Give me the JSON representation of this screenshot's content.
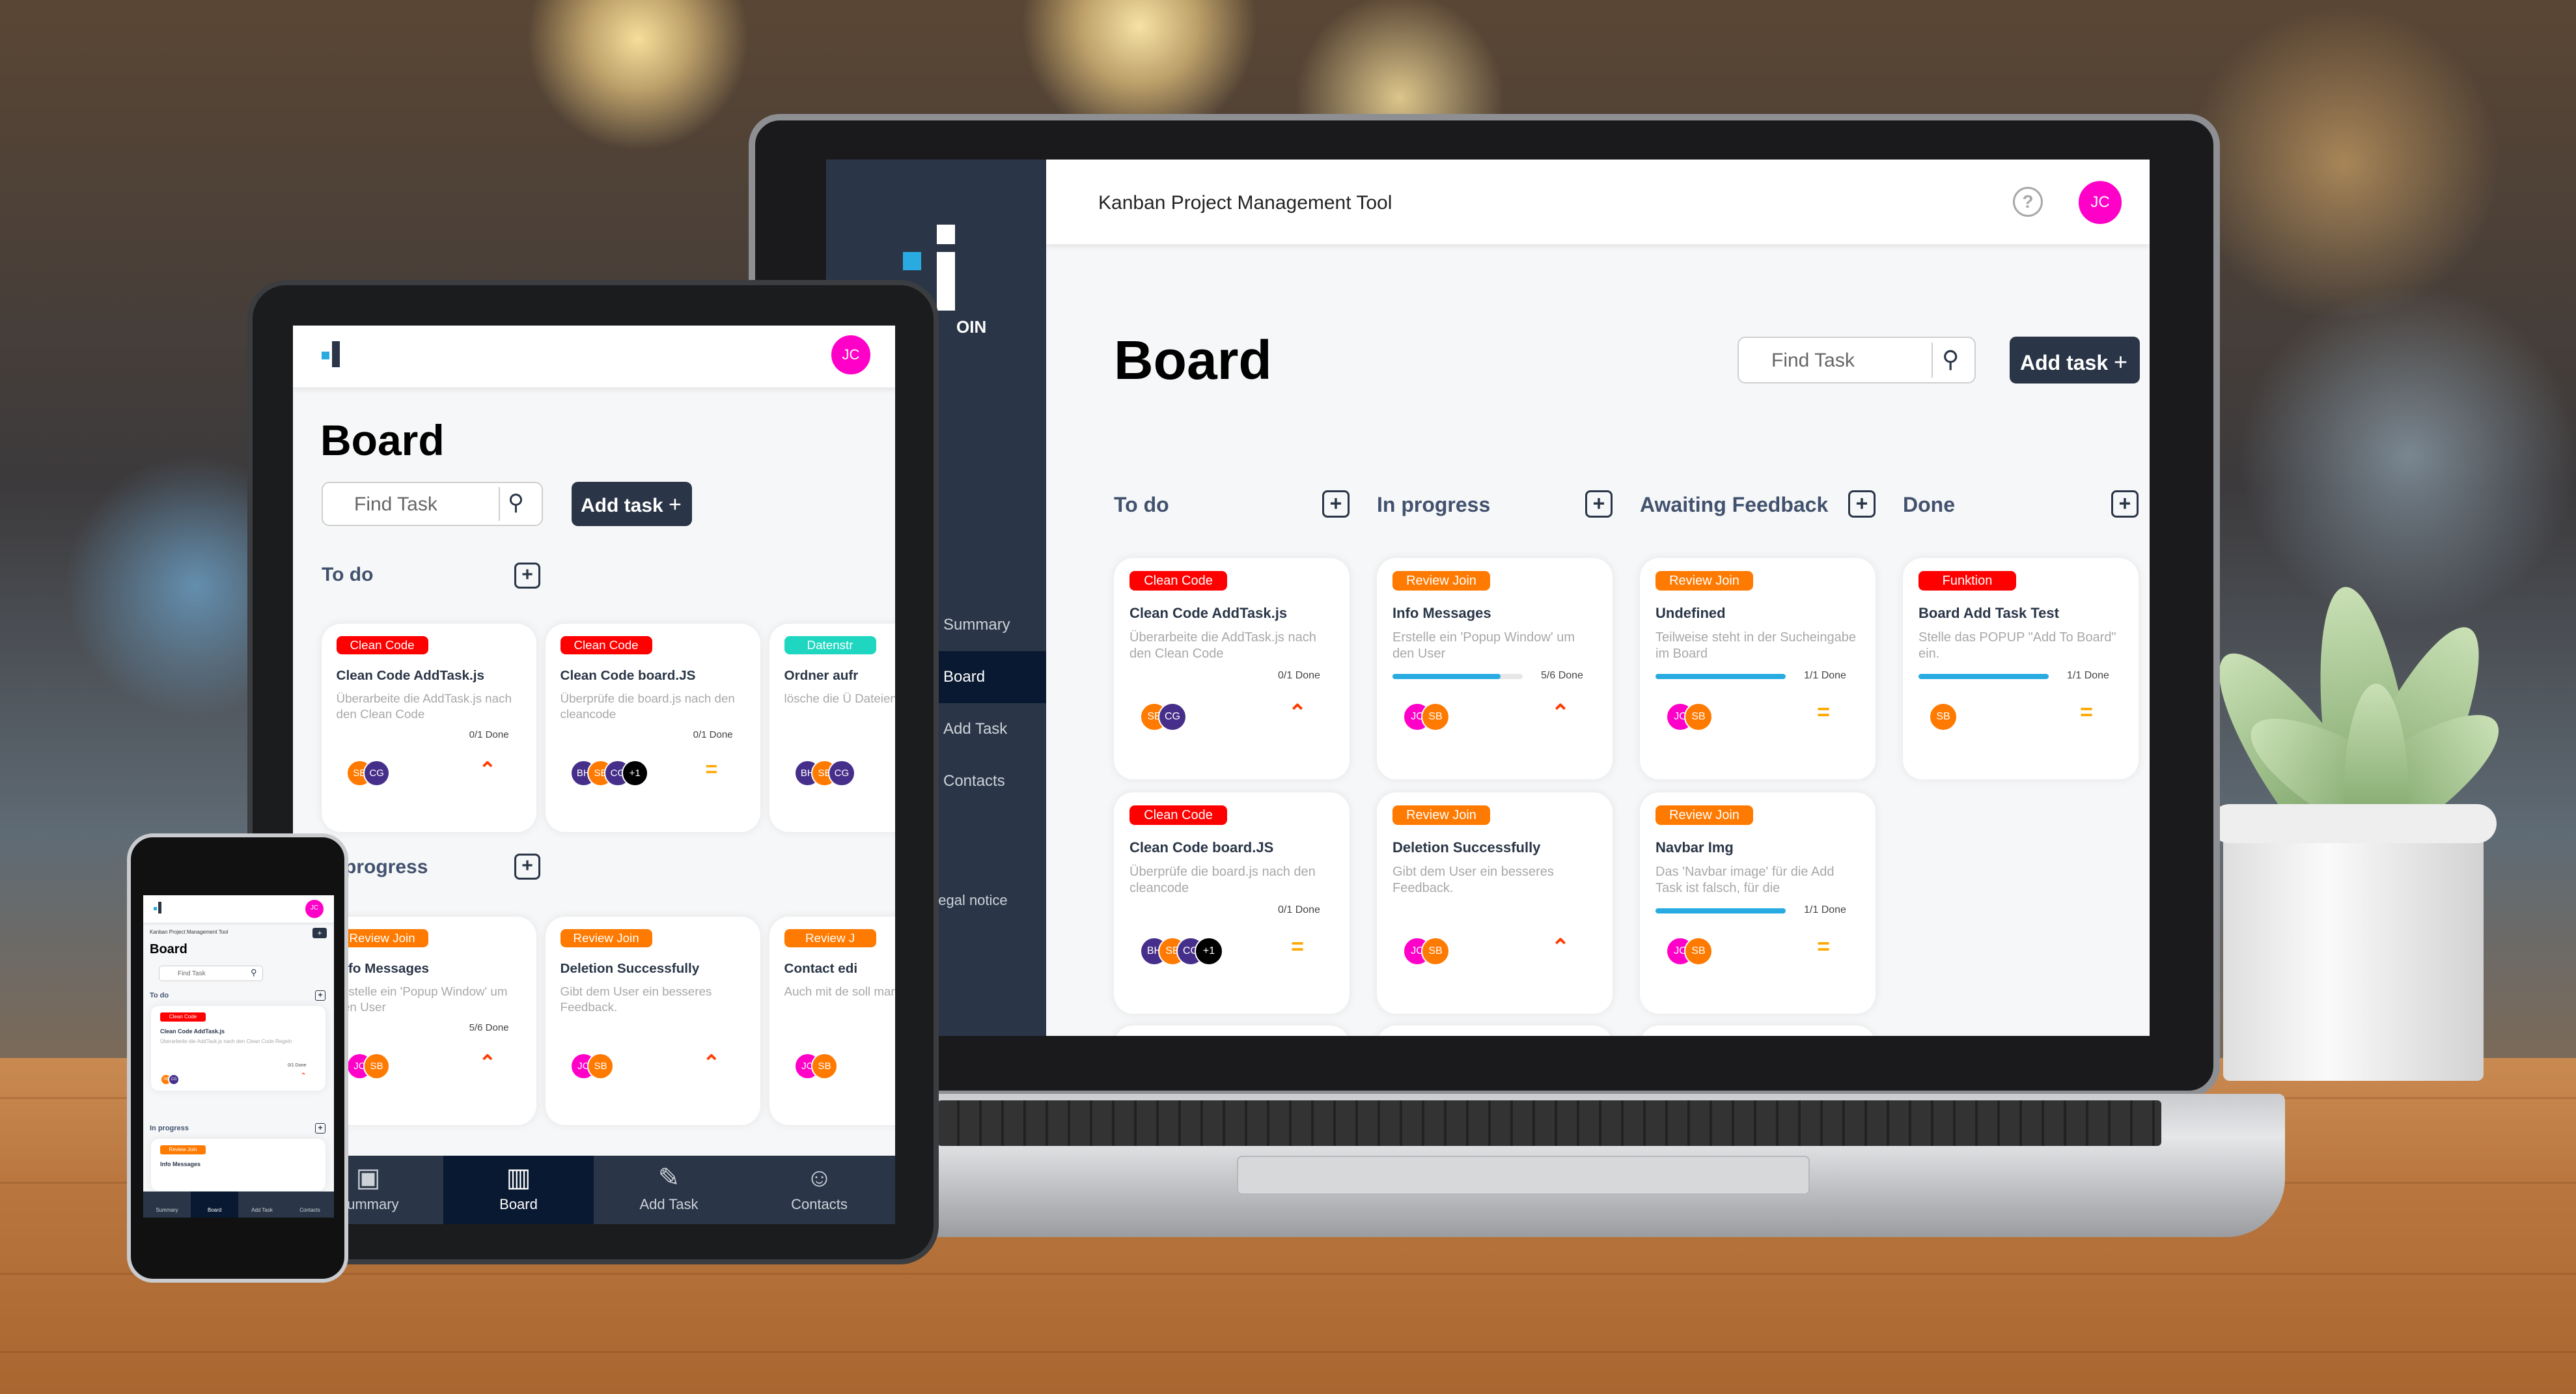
{
  "app": {
    "title": "Kanban Project Management Tool",
    "user_initials": "JC",
    "help_label": "?",
    "logo_letters": "OIN",
    "logo_mark": "j"
  },
  "sidebar": {
    "items": [
      {
        "label": "Summary"
      },
      {
        "label": "Board"
      },
      {
        "label": "Add Task"
      },
      {
        "label": "Contacts"
      }
    ],
    "legal": "Legal notice"
  },
  "board": {
    "title": "Board",
    "search_placeholder": "Find Task",
    "add_task_label": "Add task",
    "add_icon": "+",
    "columns": [
      {
        "title": "To do"
      },
      {
        "title": "In progress"
      },
      {
        "title": "Awaiting Feedback"
      },
      {
        "title": "Done"
      }
    ],
    "cards": [
      {
        "tag": "Clean Code",
        "title": "Clean Code AddTask.js",
        "desc": "Überarbeite die AddTask.js nach den Clean Code",
        "done": "0/1 Done",
        "progress": 0.0,
        "avatars": [
          "SB",
          "CG"
        ],
        "prio": "^"
      },
      {
        "tag": "Clean Code",
        "title": "Clean Code board.JS",
        "desc": "Überprüfe die board.js nach den cleancode",
        "done": "0/1 Done",
        "progress": 0.0,
        "avatars": [
          "BH",
          "SB",
          "CG",
          "+1"
        ],
        "prio": "="
      },
      {
        "tag": "Review Join",
        "title": "Info Messages",
        "desc": "Erstelle ein 'Popup Window' um den User",
        "done": "5/6 Done",
        "progress": 0.83,
        "avatars": [
          "JC",
          "SB"
        ],
        "prio": "^"
      },
      {
        "tag": "Review Join",
        "title": "Deletion Successfully",
        "desc": "Gibt dem User ein besseres Feedback.",
        "done": "",
        "progress": 0.0,
        "avatars": [
          "JC",
          "SB"
        ],
        "prio": "^"
      },
      {
        "tag": "Review Join",
        "title": "Undefined",
        "desc": "Teilweise steht in der Sucheingabe im Board",
        "done": "1/1 Done",
        "progress": 1.0,
        "avatars": [
          "JC",
          "SB"
        ],
        "prio": "="
      },
      {
        "tag": "Review Join",
        "title": "Navbar Img",
        "desc": "Das 'Navbar image' für die Add Task ist falsch, für die",
        "done": "1/1 Done",
        "progress": 1.0,
        "avatars": [
          "JC",
          "SB"
        ],
        "prio": "="
      },
      {
        "tag": "Funktion",
        "title": "Board Add Task Test",
        "desc": "Stelle das POPUP \"Add To Board\" ein.",
        "done": "1/1 Done",
        "progress": 1.0,
        "avatars": [
          "SB"
        ],
        "prio": "="
      }
    ]
  },
  "tablet": {
    "columns": [
      {
        "title": "To do"
      },
      {
        "title": "In progress"
      }
    ],
    "cards": [
      {
        "tag": "Clean Code",
        "title": "Clean Code AddTask.js",
        "desc": "Überarbeite die AddTask.js nach den Clean Code",
        "done": "0/1 Done",
        "avatars": [
          "SB",
          "CG"
        ],
        "prio": "^"
      },
      {
        "tag": "Clean Code",
        "title": "Clean Code board.JS",
        "desc": "Überprüfe die board.js nach den cleancode",
        "done": "0/1 Done",
        "avatars": [
          "BH",
          "SB",
          "CG",
          "+1"
        ],
        "prio": "="
      },
      {
        "tag": "Datenstr",
        "title": "Ordner aufr",
        "desc": "lösche die Ü Dateien im j",
        "done": "",
        "avatars": [
          "BH",
          "SB",
          "CG"
        ],
        "prio": ""
      },
      {
        "tag": "Review Join",
        "title": "Info Messages",
        "desc": "Erstelle ein 'Popup Window' um den User",
        "done": "5/6 Done",
        "avatars": [
          "JC",
          "SB"
        ],
        "prio": "^"
      },
      {
        "tag": "Review Join",
        "title": "Deletion Successfully",
        "desc": "Gibt dem User ein besseres Feedback.",
        "done": "",
        "avatars": [
          "JC",
          "SB"
        ],
        "prio": "^"
      },
      {
        "tag": "Review J",
        "title": "Contact edi",
        "desc": "Auch mit de soll man neu",
        "done": "",
        "avatars": [
          "JC",
          "SB"
        ],
        "prio": ""
      }
    ],
    "nav": [
      {
        "label": "Summary",
        "icon": "▣"
      },
      {
        "label": "Board",
        "icon": "▥"
      },
      {
        "label": "Add Task",
        "icon": "✎"
      },
      {
        "label": "Contacts",
        "icon": "☺"
      }
    ]
  },
  "phone": {
    "title": "Kanban Project Management Tool",
    "board_title": "Board",
    "search_placeholder": "Find Task",
    "col1": "To do",
    "col2": "In progress",
    "card1_tag": "Clean Code",
    "card1_title": "Clean Code AddTask.js",
    "card1_desc": "Überarbeite die AddTask.js nach den Clean Code Regeln",
    "card1_done": "0/1 Done",
    "card2_tag": "Review Join",
    "card2_title": "Info Messages",
    "nav": [
      "Summary",
      "Board",
      "Add Task",
      "Contacts"
    ]
  }
}
